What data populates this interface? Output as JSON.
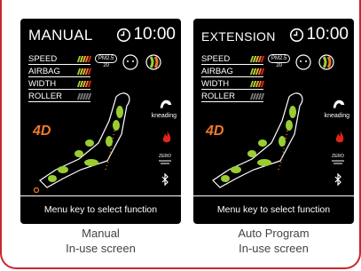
{
  "screens": [
    {
      "title": "MANUAL",
      "time": "10:00",
      "rows": [
        {
          "label": "SPEED",
          "level": 5
        },
        {
          "label": "AIRBAG",
          "level": 5
        },
        {
          "label": "WIDTH",
          "level": 5
        },
        {
          "label": "ROLLER",
          "level": 0
        }
      ],
      "pm_label": "PM2.5",
      "pm_value": "20",
      "mode_4d": "4D",
      "kneading": "kneading",
      "zero": "ZERO",
      "footer": "Menu key to select function"
    },
    {
      "title": "EXTENSION",
      "time": "10:00",
      "rows": [
        {
          "label": "SPEED",
          "level": 5
        },
        {
          "label": "AIRBAG",
          "level": 5
        },
        {
          "label": "WIDTH",
          "level": 5
        },
        {
          "label": "ROLLER",
          "level": 0
        }
      ],
      "pm_label": "PM2.5",
      "pm_value": "20",
      "mode_4d": "4D",
      "kneading": "kneading",
      "zero": "ZERO",
      "footer": "Menu key to select function"
    }
  ],
  "captions": [
    {
      "line1": "Manual",
      "line2": "In-use screen"
    },
    {
      "line1": "Auto Program",
      "line2": "In-use screen"
    }
  ],
  "colors": {
    "border": "#c8282d",
    "accent_green": "#9acd32",
    "accent_orange": "#f07a2a"
  }
}
